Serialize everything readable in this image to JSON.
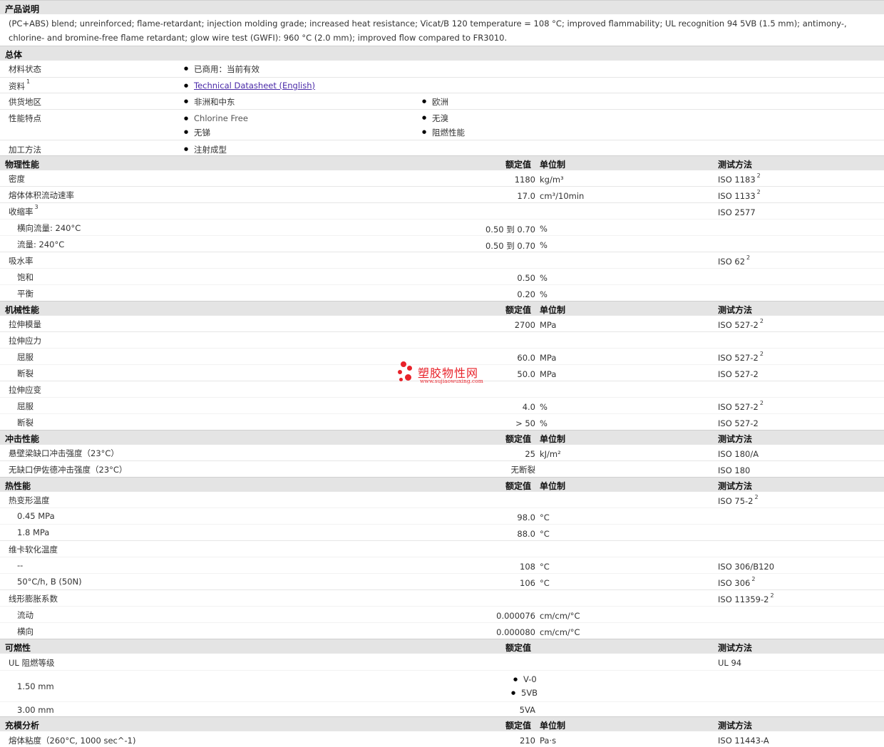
{
  "desc": {
    "title": "产品说明",
    "text": "(PC+ABS) blend; unreinforced; flame-retardant; injection molding grade; increased heat resistance; Vicat/B 120 temperature = 108 °C; improved flammability; UL recognition 94 5VB (1.5 mm); antimony-, chlorine- and bromine-free flame retardant; glow wire test (GWFI): 960 °C (2.0 mm); improved flow compared to FR3010."
  },
  "general": {
    "title": "总体",
    "material_status_label": "材料状态",
    "material_status_value": "已商用：当前有效",
    "docs_label": "资料",
    "docs_sup": "1",
    "docs_link": "Technical Datasheet (English)",
    "region_label": "供货地区",
    "region_1": "非洲和中东",
    "region_2": "欧洲",
    "features_label": "性能特点",
    "feature_1": "Chlorine Free",
    "feature_2": "无溴",
    "feature_3": "无锑",
    "feature_4": "阻燃性能",
    "process_label": "加工方法",
    "process_value": "注射成型"
  },
  "headers": {
    "nominal": "额定值",
    "unit": "单位制",
    "test": "测试方法"
  },
  "physical": {
    "title": "物理性能",
    "density": {
      "label": "密度",
      "value": "1180",
      "unit": "kg/m³",
      "test": "ISO 1183",
      "sup": "2"
    },
    "mvr": {
      "label": "熔体体积流动速率",
      "value": "17.0",
      "unit": "cm³/10min",
      "test": "ISO 1133",
      "sup": "2"
    },
    "shrink": {
      "label": "收缩率",
      "sup": "3",
      "test": "ISO 2577"
    },
    "shrink_cross": {
      "label": "横向流量: 240°C",
      "value": "0.50 到  0.70",
      "unit": "%"
    },
    "shrink_flow": {
      "label": "流量: 240°C",
      "value": "0.50 到  0.70",
      "unit": "%"
    },
    "water": {
      "label": "吸水率",
      "test": "ISO 62",
      "sup": "2"
    },
    "water_sat": {
      "label": "饱和",
      "value": "0.50",
      "unit": "%"
    },
    "water_eq": {
      "label": "平衡",
      "value": "0.20",
      "unit": "%"
    }
  },
  "mechanical": {
    "title": "机械性能",
    "modulus": {
      "label": "拉伸模量",
      "value": "2700",
      "unit": "MPa",
      "test": "ISO 527-2",
      "sup": "2"
    },
    "stress": {
      "label": "拉伸应力"
    },
    "stress_yield": {
      "label": "屈服",
      "value": "60.0",
      "unit": "MPa",
      "test": "ISO 527-2",
      "sup": "2"
    },
    "stress_break": {
      "label": "断裂",
      "value": "50.0",
      "unit": "MPa",
      "test": "ISO 527-2"
    },
    "strain": {
      "label": "拉伸应变"
    },
    "strain_yield": {
      "label": "屈服",
      "value": "4.0",
      "unit": "%",
      "test": "ISO 527-2",
      "sup": "2"
    },
    "strain_break": {
      "label": "断裂",
      "value": "> 50",
      "unit": "%",
      "test": "ISO 527-2"
    }
  },
  "impact": {
    "title": "冲击性能",
    "izod": {
      "label": "悬壁梁缺口冲击强度（23°C）",
      "value": "25",
      "unit": "kJ/m²",
      "test": "ISO 180/A"
    },
    "unnotched": {
      "label": "无缺口伊佐德冲击强度（23°C）",
      "value": "无断裂",
      "test": "ISO 180"
    }
  },
  "thermal": {
    "title": "热性能",
    "hdt": {
      "label": "热变形温度",
      "test": "ISO 75-2",
      "sup": "2"
    },
    "hdt_045": {
      "label": "0.45 MPa",
      "value": "98.0",
      "unit": "°C"
    },
    "hdt_18": {
      "label": "1.8 MPa",
      "value": "88.0",
      "unit": "°C"
    },
    "vicat": {
      "label": "维卡软化温度"
    },
    "vicat_1": {
      "label": "--",
      "value": "108",
      "unit": "°C",
      "test": "ISO 306/B120"
    },
    "vicat_2": {
      "label": "50°C/h, B (50N)",
      "value": "106",
      "unit": "°C",
      "test": "ISO 306",
      "sup": "2"
    },
    "clte": {
      "label": "线形膨胀系数",
      "test": "ISO 11359-2",
      "sup": "2"
    },
    "clte_flow": {
      "label": "流动",
      "value": "0.000076",
      "unit": "cm/cm/°C"
    },
    "clte_cross": {
      "label": "横向",
      "value": "0.000080",
      "unit": "cm/cm/°C"
    }
  },
  "flammability": {
    "title": "可燃性",
    "ul": {
      "label": "UL 阻燃等级",
      "test": "UL 94"
    },
    "ul_150": {
      "label": "1.50 mm",
      "value_1": "V-0",
      "value_2": "5VB"
    },
    "ul_300": {
      "label": "3.00 mm",
      "value": "5VA"
    }
  },
  "fill": {
    "title": "充模分析",
    "viscosity": {
      "label": "熔体粘度（260°C, 1000 sec^-1)",
      "value": "210",
      "unit": "Pa·s",
      "test": "ISO 11443-A"
    }
  },
  "watermark": {
    "cn": "塑胶物性网",
    "en": "www.sujiaowuxing.com",
    "color": "#e8222a"
  }
}
